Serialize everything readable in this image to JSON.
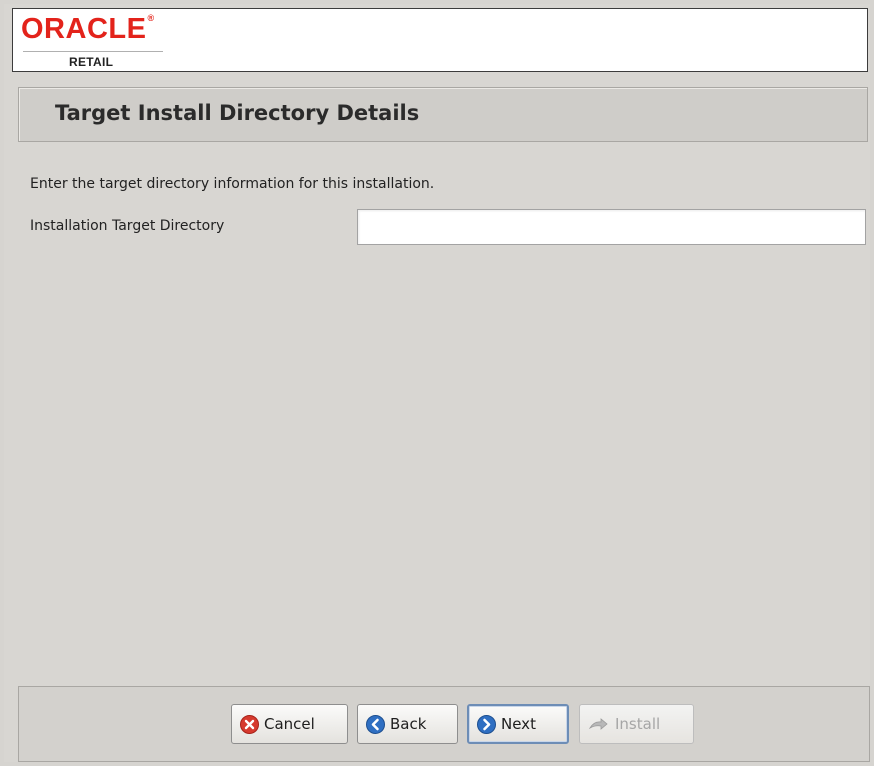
{
  "brand": {
    "logo_text": "ORACLE",
    "logo_mark": "®",
    "sub_brand": "RETAIL"
  },
  "page": {
    "title": "Target Install Directory Details",
    "intro": "Enter the target directory information for this installation."
  },
  "form": {
    "target_dir_label": "Installation Target Directory",
    "target_dir_value": ""
  },
  "buttons": {
    "cancel": {
      "label": "Cancel",
      "icon": "cancel-x-icon"
    },
    "back": {
      "label": "Back",
      "icon": "back-arrow-icon"
    },
    "next": {
      "label": "Next",
      "icon": "next-arrow-icon"
    },
    "install": {
      "label": "Install",
      "icon": "install-arrow-icon",
      "enabled": false
    }
  },
  "colors": {
    "oracle_red": "#e3231b",
    "button_blue": "#2f6fc2",
    "cancel_red": "#d63a2e"
  }
}
